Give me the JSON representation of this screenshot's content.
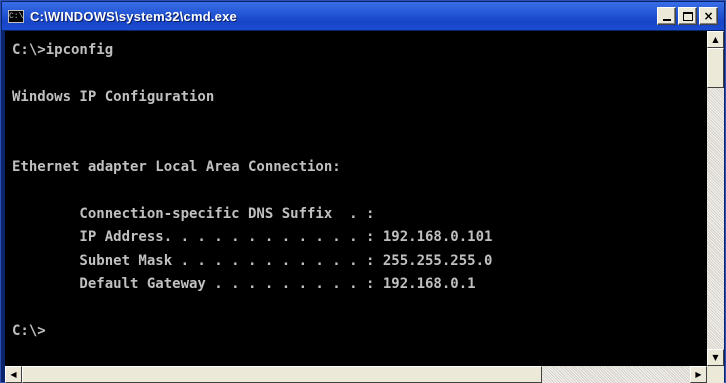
{
  "window": {
    "title": "C:\\WINDOWS\\system32\\cmd.exe",
    "icon": "console-icon",
    "icon_glyph": "C:\\",
    "buttons": {
      "minimize_icon": "minimize-icon",
      "maximize_icon": "maximize-icon",
      "close_label": "×"
    }
  },
  "console": {
    "foreground": "#c0c0c0",
    "background": "#000000",
    "lines": [
      "C:\\>ipconfig",
      "",
      "Windows IP Configuration",
      "",
      "",
      "Ethernet adapter Local Area Connection:",
      "",
      "        Connection-specific DNS Suffix  . :",
      "        IP Address. . . . . . . . . . . . : 192.168.0.101",
      "        Subnet Mask . . . . . . . . . . . : 255.255.255.0",
      "        Default Gateway . . . . . . . . . : 192.168.0.1",
      "",
      "C:\\>"
    ]
  },
  "scrollbars": {
    "up_arrow": "▲",
    "down_arrow": "▼",
    "left_arrow": "◀",
    "right_arrow": "▶"
  }
}
